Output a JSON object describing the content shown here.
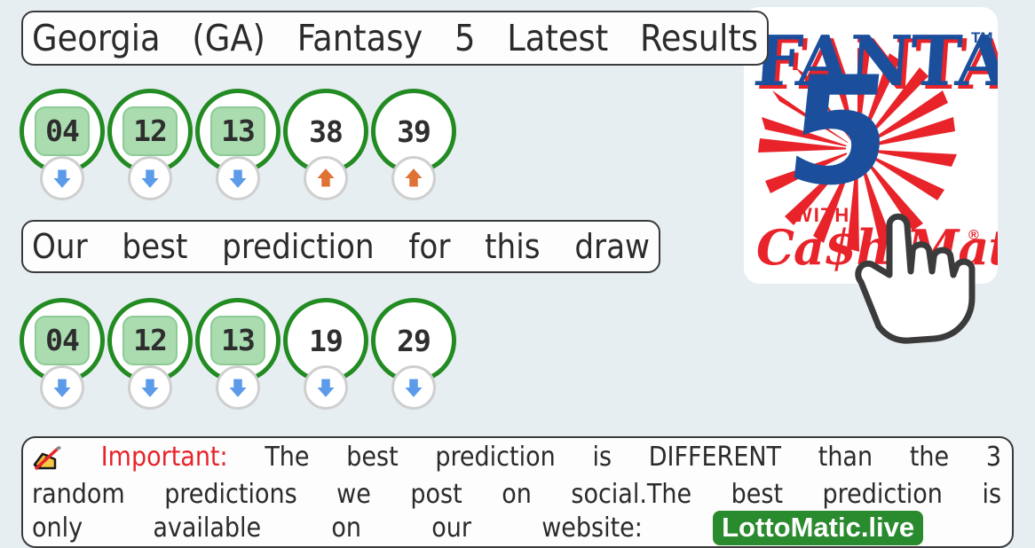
{
  "page": {
    "background_color": "#e7eef2",
    "title": "Georgia (GA) Fantasy 5 Latest Results"
  },
  "header": {
    "title_words": [
      "Georgia",
      "(GA)",
      "Fantasy",
      "5",
      "Latest",
      "Results"
    ],
    "title_text": "Georgia (GA) Fantasy 5 Latest Results"
  },
  "logo": {
    "brand": "FANTASY",
    "number": "5",
    "with_word": "WITH",
    "sub_brand": "Cash Match",
    "trademark": "TM",
    "registered": "®",
    "brand_color": "#1b4f9c",
    "accent_color": "#e8232a",
    "cursor_icon": "pointing-hand-cursor-icon"
  },
  "latest_results": {
    "label": "Georgia (GA) Fantasy 5 Latest Results",
    "balls": [
      {
        "number": "04",
        "highlight": true,
        "trend": "down",
        "trend_icon": "arrow-down-icon"
      },
      {
        "number": "12",
        "highlight": true,
        "trend": "down",
        "trend_icon": "arrow-down-icon"
      },
      {
        "number": "13",
        "highlight": true,
        "trend": "down",
        "trend_icon": "arrow-down-icon"
      },
      {
        "number": "38",
        "highlight": false,
        "trend": "up",
        "trend_icon": "arrow-up-icon"
      },
      {
        "number": "39",
        "highlight": false,
        "trend": "up",
        "trend_icon": "arrow-up-icon"
      }
    ]
  },
  "banner": {
    "text": "Our best prediction for this draw",
    "words": [
      "Our",
      "best",
      "prediction",
      "for",
      "this",
      "draw"
    ]
  },
  "best_prediction": {
    "balls": [
      {
        "number": "04",
        "highlight": true,
        "trend": "down",
        "trend_icon": "arrow-down-icon"
      },
      {
        "number": "12",
        "highlight": true,
        "trend": "down",
        "trend_icon": "arrow-down-icon"
      },
      {
        "number": "13",
        "highlight": true,
        "trend": "down",
        "trend_icon": "arrow-down-icon"
      },
      {
        "number": "19",
        "highlight": false,
        "trend": "down",
        "trend_icon": "arrow-down-icon"
      },
      {
        "number": "29",
        "highlight": false,
        "trend": "down",
        "trend_icon": "arrow-down-icon"
      }
    ]
  },
  "notice": {
    "icon": "writing-hand-icon",
    "important_label": "Important:",
    "line1_words": [
      "The",
      "best",
      "prediction",
      "is",
      "DIFFERENT",
      "than",
      "the",
      "3"
    ],
    "line2_words": [
      "random",
      "predictions",
      "we",
      "post",
      "on",
      "social.The",
      "best",
      "prediction",
      "is"
    ],
    "line3_words": [
      "only",
      "available",
      "on",
      "our",
      "website:"
    ],
    "site_badge": "LottoMatic.live",
    "full_text": "Important: The best prediction is DIFFERENT than the 3 random predictions we post on social.The best prediction is only available on our website: LottoMatic.live"
  },
  "colors": {
    "ball_ring": "#228b22",
    "highlight_fill": "#aadcb0",
    "arrow_down": "#5b9bea",
    "arrow_up": "#df7234",
    "important_red": "#e8232a",
    "site_badge_green": "#2a8a2e"
  }
}
